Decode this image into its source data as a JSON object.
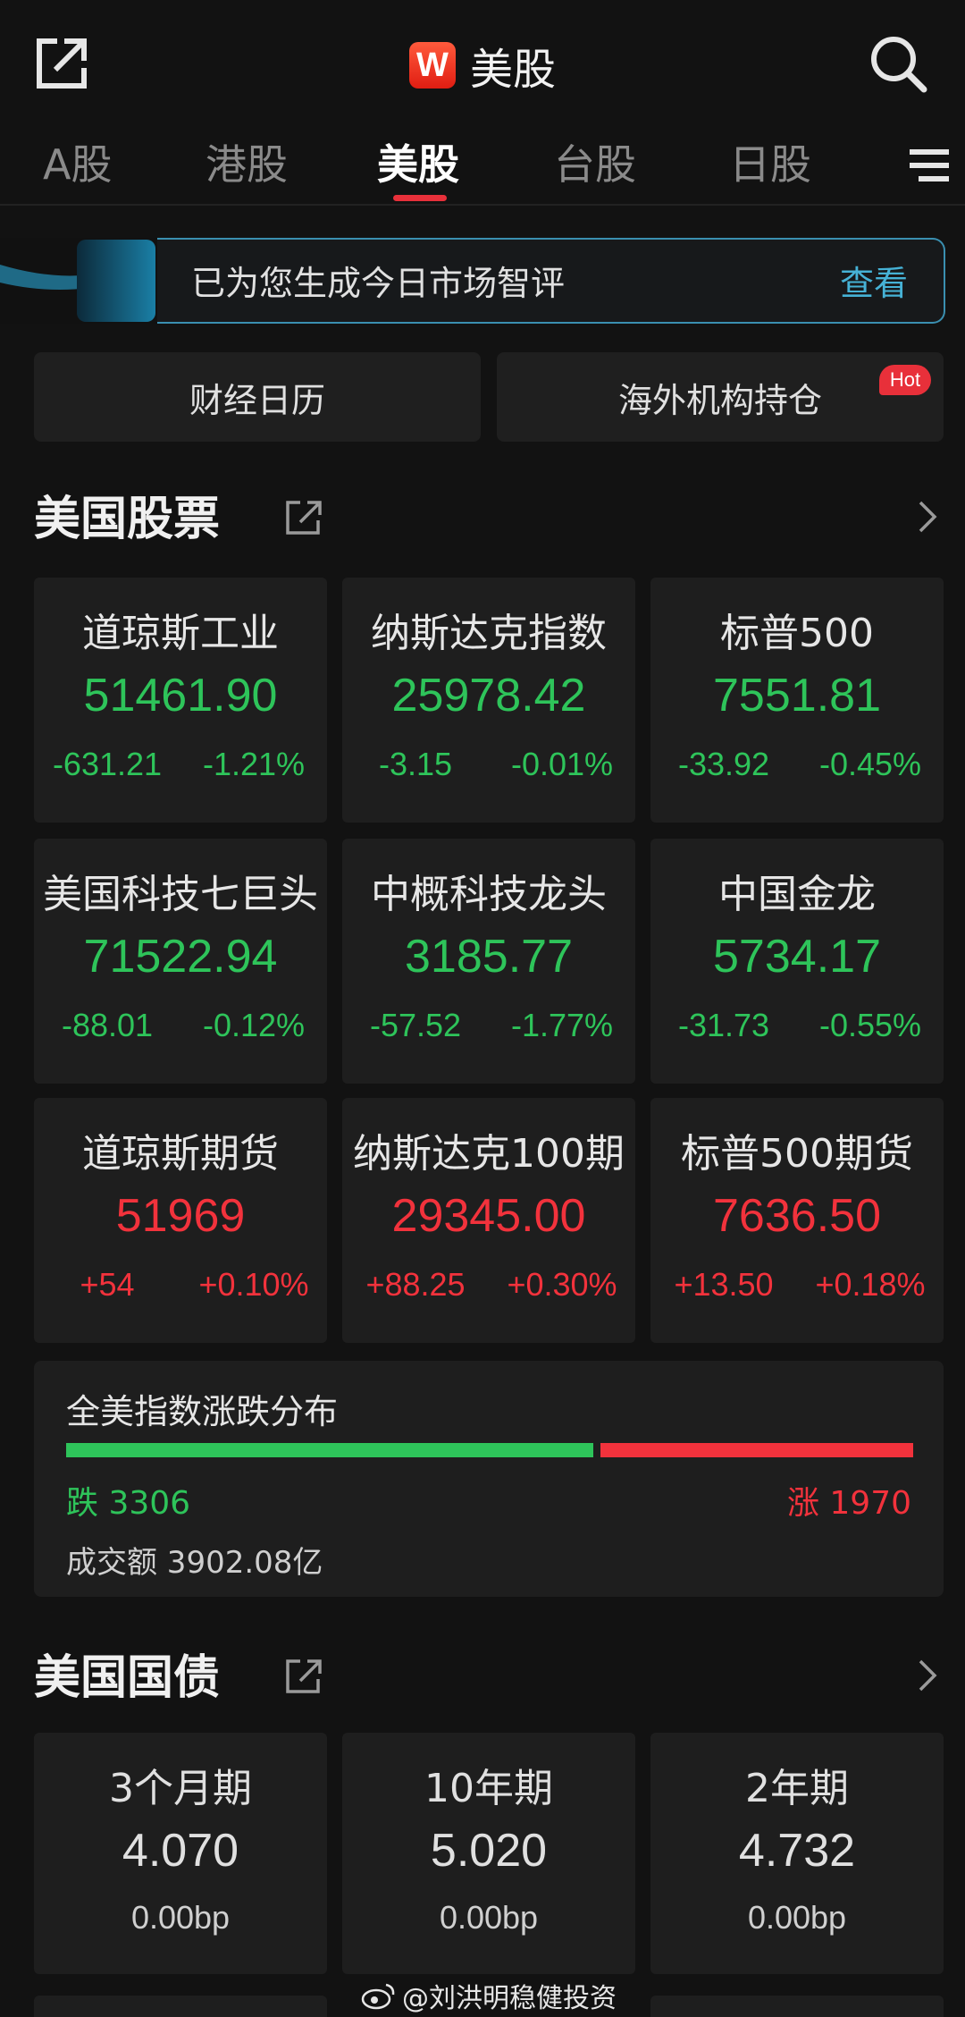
{
  "header": {
    "logo_letter": "W",
    "title": "美股",
    "brand_color": "#e8303a"
  },
  "tabs": [
    {
      "label": "A股",
      "active": false
    },
    {
      "label": "港股",
      "active": false
    },
    {
      "label": "美股",
      "active": true
    },
    {
      "label": "台股",
      "active": false
    },
    {
      "label": "日股",
      "active": false
    }
  ],
  "banner": {
    "text": "已为您生成今日市场智评",
    "link": "查看"
  },
  "quick_buttons": [
    {
      "label": "财经日历"
    },
    {
      "label": "海外机构持仓",
      "badge": "Hot"
    }
  ],
  "us_stocks": {
    "title": "美国股票",
    "indices": [
      {
        "name": "道琼斯工业",
        "value": "51461.90",
        "change": "-631.21",
        "pct": "-1.21%",
        "direction": "down"
      },
      {
        "name": "纳斯达克指数",
        "value": "25978.42",
        "change": "-3.15",
        "pct": "-0.01%",
        "direction": "down"
      },
      {
        "name": "标普500",
        "value": "7551.81",
        "change": "-33.92",
        "pct": "-0.45%",
        "direction": "down"
      },
      {
        "name": "美国科技七巨头",
        "value": "71522.94",
        "change": "-88.01",
        "pct": "-0.12%",
        "direction": "down"
      },
      {
        "name": "中概科技龙头",
        "value": "3185.77",
        "change": "-57.52",
        "pct": "-1.77%",
        "direction": "down"
      },
      {
        "name": "中国金龙",
        "value": "5734.17",
        "change": "-31.73",
        "pct": "-0.55%",
        "direction": "down"
      },
      {
        "name": "道琼斯期货",
        "value": "51969",
        "change": "+54",
        "pct": "+0.10%",
        "direction": "up"
      },
      {
        "name": "纳斯达克100期",
        "value": "29345.00",
        "change": "+88.25",
        "pct": "+0.30%",
        "direction": "up"
      },
      {
        "name": "标普500期货",
        "value": "7636.50",
        "change": "+13.50",
        "pct": "+0.18%",
        "direction": "up"
      }
    ]
  },
  "distribution": {
    "title": "全美指数涨跌分布",
    "fall_label": "跌 3306",
    "rise_label": "涨 1970",
    "fall_count": 3306,
    "rise_count": 1970,
    "turnover": "成交额 3902.08亿",
    "fall_color": "#2ec45a",
    "rise_color": "#f2323c"
  },
  "treasuries": {
    "title": "美国国债",
    "bonds": [
      {
        "name": "3个月期",
        "yield": "4.070",
        "change": "0.00bp"
      },
      {
        "name": "10年期",
        "yield": "5.020",
        "change": "0.00bp"
      },
      {
        "name": "2年期",
        "yield": "4.732",
        "change": "0.00bp"
      }
    ]
  },
  "watermark": "@刘洪明稳健投资"
}
